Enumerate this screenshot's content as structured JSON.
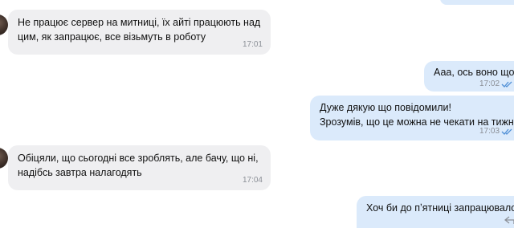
{
  "messages": [
    {
      "direction": "incoming",
      "text": "Не працює сервер на митниці, їх айті працюють над\nцим, як запрацює, все візьмуть в роботу",
      "time": "17:01"
    },
    {
      "direction": "outgoing",
      "text": "Ааа, ось воно що",
      "time": "17:02",
      "status": "read"
    },
    {
      "direction": "outgoing",
      "text": "Дуже дякую що повідомили!\nЗрозумів, що це можна не чекати на тижні ,",
      "time": "17:03",
      "status": "read"
    },
    {
      "direction": "incoming",
      "text": "Обіцяли, що сьогодні все зроблять, але бачу, що ні,\nнадібсь завтра налагодять",
      "time": "17:04"
    },
    {
      "direction": "outgoing",
      "text": "Хоч би до пʼятниці запрацювало..",
      "time": ""
    }
  ],
  "icons": {
    "read_status": "double-check-icon",
    "reply": "reply-icon"
  },
  "colors": {
    "incoming_bubble": "#efeff1",
    "outgoing_bubble": "#dbeafb",
    "time_text": "#8b8f96",
    "read_check": "#4f8fd6"
  }
}
